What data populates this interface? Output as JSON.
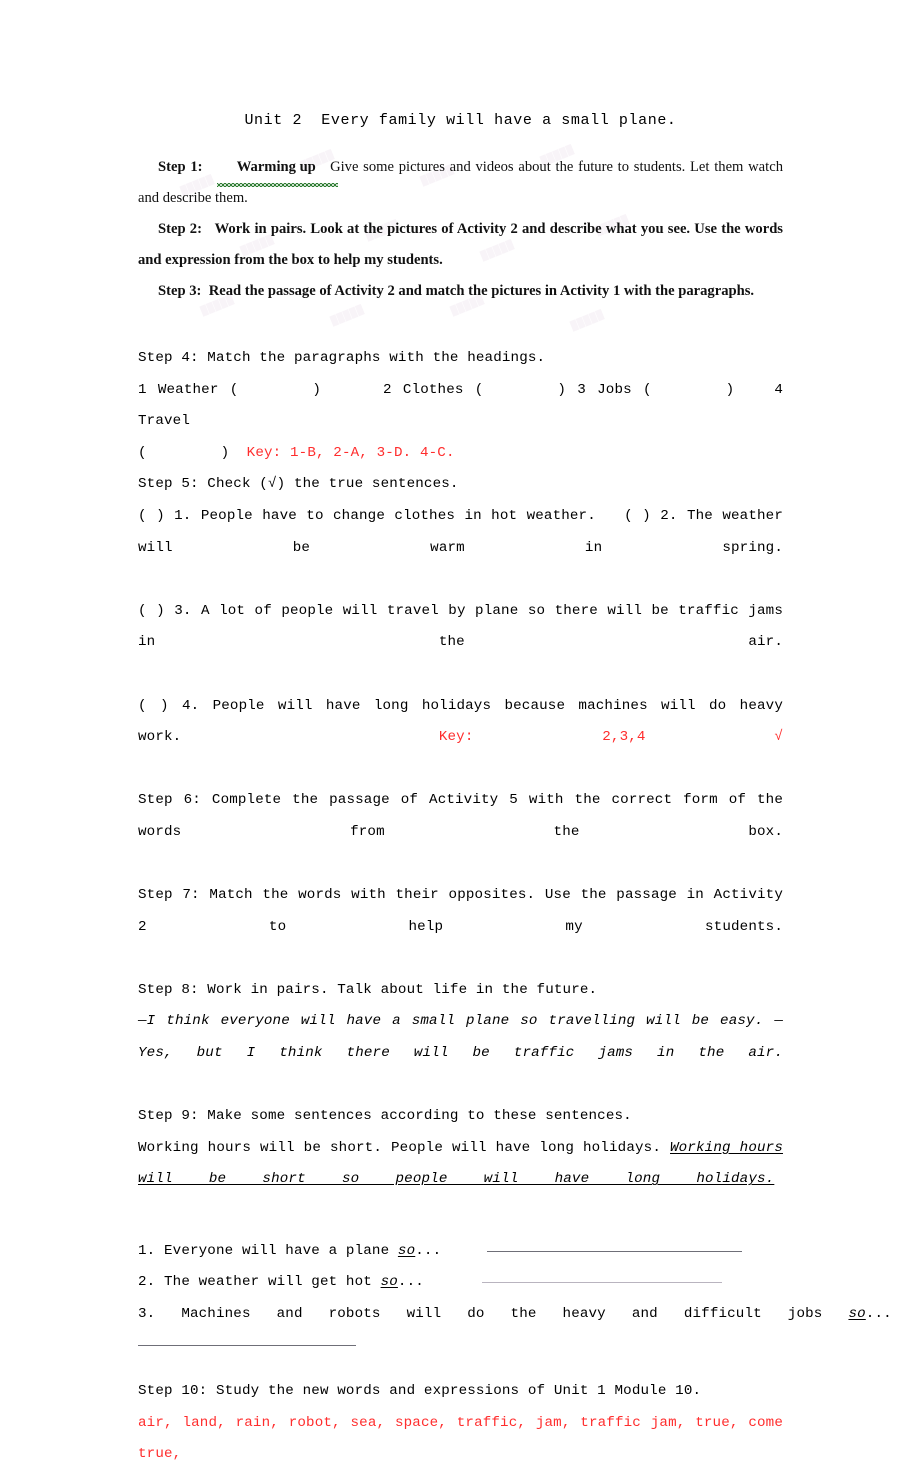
{
  "document": {
    "title": "Unit 2  Every family will have a small plane.",
    "colors": {
      "red": "#ff2d2d",
      "spellcheck_green": "#2e7d32",
      "rule_gray": "#6f6f78"
    },
    "watermark_text": "    "
  },
  "steps_bold": {
    "step1_label": "Step 1:",
    "step1_topic": "Warming up",
    "step1_text": "Give some pictures and videos about the future to students. Let them watch and describe them.",
    "step2_label": "Step 2:",
    "step2_text": "Work in pairs. Look at the pictures of Activity 2 and describe what you see. Use the words and expression from the box to help my students.",
    "step3_label": "Step 3:",
    "step3_text": "Read the passage of Activity 2 and match the pictures in Activity 1 with the paragraphs."
  },
  "steps_mono": {
    "step4_heading": "Step 4: Match the paragraphs with the headings.",
    "step4_items": [
      "1 Weather (",
      ")",
      "2 Clothes (",
      ") 3 Jobs (",
      ")",
      "4 Travel",
      "(",
      ")"
    ],
    "step4_key": "Key: 1-B, 2-A, 3-D. 4-C.",
    "step5_heading": "Step 5: Check (√) the true sentences.",
    "step5_s1": "(   ) 1. People have to change clothes in hot weather.",
    "step5_s2": "(   ) 2. The weather will be warm in spring.",
    "step5_s3": "(   ) 3. A lot of people will travel by plane so there will be traffic jams in the air.",
    "step5_s4": "(   ) 4. People will have long holidays because machines will do heavy work.",
    "step5_key_label": "Key:",
    "step5_key_value": "2,3,4 √",
    "step6_heading": "Step 6: Complete the passage of Activity 5 with the correct form of the words from the box.",
    "step7_heading": "Step 7: Match the words with their opposites. Use the passage in Activity 2 to help my students.",
    "step8_heading": "Step 8: Work in pairs. Talk about life in the future.",
    "step8_dialogue": "—I think everyone will have a small plane so travelling will be easy. —Yes, but I think there will be traffic jams in the air.",
    "step9_heading": "Step 9: Make some sentences according to these sentences.",
    "step9_example_prompt": "Working hours will be short. People will have long holidays.",
    "step9_example_answer": "Working hours will be short so people will have long holidays.",
    "step9_item1_text": "1. Everyone will have a plane ",
    "step9_item1_so": "so",
    "step9_item1_tail": "...",
    "step9_item2_text": "2. The weather will get hot ",
    "step9_item2_so": "so",
    "step9_item2_tail": "...",
    "step9_item3_text": "3.   Machines   and   robots   will   do   the   heavy   and   difficult   jobs   ",
    "step9_item3_so": "so",
    "step9_item3_tail": "...",
    "step10_heading": "Step 10:  Study the new words and expressions of Unit 1 Module 10.",
    "step10_words": "air, land, rain, robot, sea, space, traffic, jam, traffic jam, true, come true,"
  }
}
